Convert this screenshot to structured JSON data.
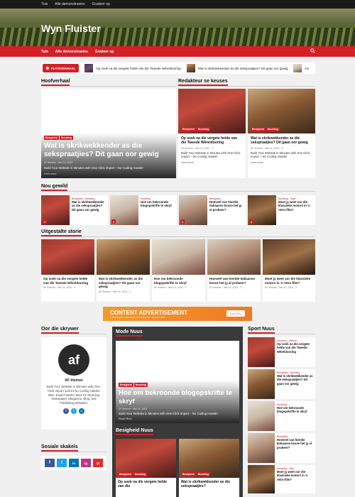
{
  "topbar": {
    "links": [
      "Tuis",
      "Alle demonstrasies",
      "Gradeer op"
    ]
  },
  "site": {
    "title": "Wyn Fluister"
  },
  "nav": {
    "links": [
      "Tuis",
      "Alle demonstrasies",
      "Gradeer op"
    ]
  },
  "ticker": {
    "label": "FLITSVERHAAL",
    "items": [
      "Op soek na die vergete helde van die Tweede Wêreldoorlog",
      "Wat is skrikwekkender as die sekspraatjies? Dit gaan oor gewig",
      "Ho"
    ]
  },
  "sections": {
    "hoofverhaal": "Hoofverhaal",
    "redakteur": "Redakteur se keuses",
    "nougewild": "Nou gewild",
    "uitgestalte": "Uitgestalte storie",
    "skrywer": "Oor die skrywer",
    "mode": "Mode Nuus",
    "sport": "Sport Nuus",
    "sosiale": "Sosiale skakels",
    "besigheid": "Besigheid Nuus"
  },
  "main_story": {
    "badges": [
      "Besigheid",
      "Nuusting"
    ],
    "title": "Wat is skrikwekkender as die sekspraatjies? Dit gaan oor gewig",
    "author": "AF themes",
    "date": "Mei 14, 2024",
    "excerpt": "Build Your Website in Minutes with One-Click Import – No Coding Hassle!",
    "more": "Lees meer"
  },
  "editor": [
    {
      "badges": [
        "Besigheid",
        "Nuusting"
      ],
      "title": "Op soek na die vergete helde van die Tweede Wêreldoorlog",
      "author": "AF themes",
      "date": "Mei 14, 2024",
      "comments": "0",
      "excerpt": "Build Your Website in Minutes with One-Click Import – No Coding Hassle!",
      "more": "Lees meer"
    },
    {
      "badges": [
        "Besigheid",
        "Nuusting"
      ],
      "title": "Wat is skrikwekkender as die sekspraatjies? Dit gaan oor gewig",
      "author": "AF themes",
      "date": "Mei 14, 2024",
      "comments": "0",
      "excerpt": "Build Your Website in Minutes with One-Click Import – No Coding Hassle!",
      "more": "Lees meer"
    }
  ],
  "popular": [
    {
      "num": "1",
      "cats": "Besigheid · Nuusting",
      "title": "Wat is skrikwekkender as die sekspraatjies? Dit gaan oor gewig"
    },
    {
      "num": "2",
      "cats": "Nuusting",
      "title": "Hoe om bekroonde blogopskrifte te skryf"
    },
    {
      "num": "3",
      "cats": "Besigheid",
      "title": "Hoeveel van hierdie Italiaanse kosse het jy al probeer?"
    },
    {
      "num": "4",
      "cats": "Nuusting · Tegn",
      "title": "Moet jy weet oor die klassieke motors in 'n retro-film?"
    }
  ],
  "featured": [
    {
      "title": "Op soek na die vergete helde van die Tweede Wêreldoorlog",
      "author": "AF themes",
      "date": "Mei 14, 2024",
      "comments": "0"
    },
    {
      "title": "Wat is skrikwekkender as die sekspraatjies? Dit gaan oor gewig",
      "author": "AF themes",
      "date": "Mei 14, 2024",
      "comments": "0"
    },
    {
      "title": "Hoe om bekroonde blogopskrifte te skryf",
      "author": "AF themes",
      "date": "Mei 14, 2024",
      "comments": "0"
    },
    {
      "title": "Hoeveel van hierdie Italiaanse kosse het jy al probeer?",
      "author": "AF themes",
      "date": "Mei 14, 2024",
      "comments": "0"
    },
    {
      "title": "Moet jy weet oor die klassieke motors in 'n retro-film?",
      "author": "AF themes",
      "date": "Mei 14, 2024",
      "comments": "0"
    }
  ],
  "ad": {
    "title": "CONTENT ADVERTISEMENT",
    "sub": "CONTENT ADVERTISEMENT SECTION",
    "button": "Buy Now"
  },
  "author": {
    "name": "AF themes",
    "bio": "Build Your Website in Minutes with One-Click Import \\u2013 No Coding Hassle! 365+ Expert Starter Sites for Stunning Newspaper, Magazine, Blog, and Publishing Websites."
  },
  "mode_story": {
    "badges": [
      "Besigheid",
      "Nuusting"
    ],
    "title": "Hoe om bekroonde blogopskrifte te skryf",
    "author": "AF themes",
    "date": "Mei 14, 2024",
    "excerpt": "Build Your Website in Minutes with One-Click Import – No Coding Hassle!",
    "more": "Read More"
  },
  "sport": [
    {
      "cats": "Nuusting · Wêreld",
      "title": "Op soek na die vergete helde van die Tweede Wêreldoorlog"
    },
    {
      "cats": "Besigheid · Nuusting",
      "title": "Wat is skrikwekkender as die sekspraatjies? Dit gaan oor gewig"
    },
    {
      "cats": "Nuusting",
      "title": "Hoe om bekroonde blogopskrifte te skryf"
    },
    {
      "cats": "Besigheid",
      "title": "Hoeveel van hierdie Italiaanse kosse het jy al probeer?"
    },
    {
      "cats": "Nuusting · Tegn",
      "title": "Moet jy weet oor die klassieke motors in 'n retro-film?"
    }
  ],
  "besigheid": [
    {
      "badges": [
        "Besigheid",
        "Nuusting"
      ],
      "title": "Op soek na die vergete helde van die"
    },
    {
      "badges": [
        "Besigheid",
        "Nuusting"
      ],
      "title": "Wat is skrikwekkender as die sekspraatjies?"
    }
  ],
  "social": [
    "f",
    "t",
    "in",
    "ig",
    "yt"
  ]
}
